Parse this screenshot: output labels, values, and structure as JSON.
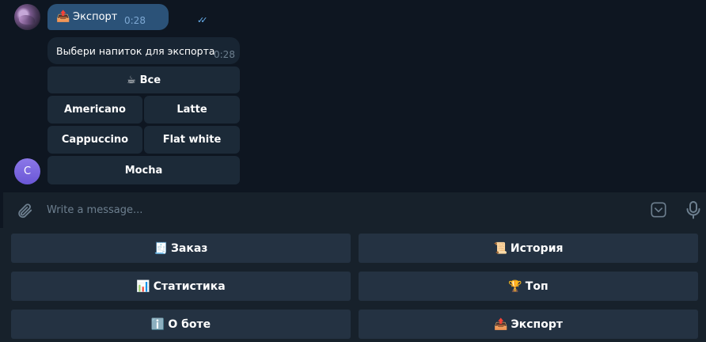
{
  "chat": {
    "outgoing": {
      "emoji": "📤",
      "text": "Экспорт",
      "time": "0:28",
      "ticks": "✓✓"
    },
    "incoming": {
      "text": "Выбери напиток для экспорта",
      "time": "0:28"
    },
    "inline_keyboard": {
      "all": {
        "emoji": "☕",
        "label": "Все"
      },
      "americano": "Americano",
      "latte": "Latte",
      "cappuccino": "Cappuccino",
      "flat_white": "Flat white",
      "mocha": "Mocha"
    },
    "bot_avatar_letter": "C"
  },
  "composer": {
    "placeholder": "Write a message..."
  },
  "reply_keyboard": {
    "order": {
      "emoji": "🧾",
      "label": "Заказ"
    },
    "history": {
      "emoji": "📜",
      "label": "История"
    },
    "stats": {
      "emoji": "📊",
      "label": "Статистика"
    },
    "top": {
      "emoji": "🏆",
      "label": "Топ"
    },
    "about": {
      "emoji": "ℹ️",
      "label": "О боте"
    },
    "export": {
      "emoji": "📤",
      "label": "Экспорт"
    }
  }
}
